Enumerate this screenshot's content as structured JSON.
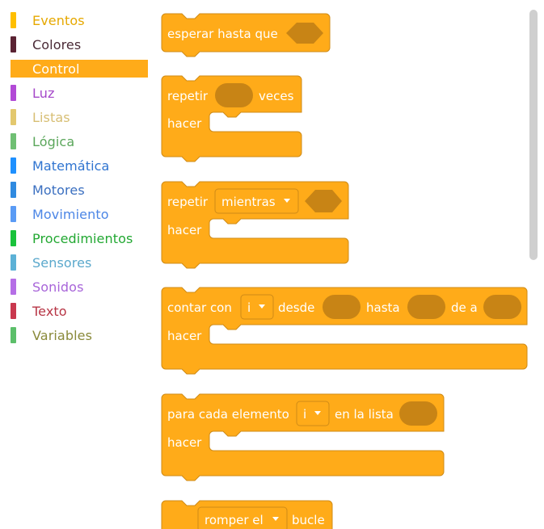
{
  "categories": [
    {
      "label": "Eventos",
      "color": "#ffbf00",
      "text_color": "#e6a800"
    },
    {
      "label": "Colores",
      "color": "#5b2333",
      "text_color": "#4a2a36"
    },
    {
      "label": "Control",
      "color": "#ffab19",
      "text_color": "#ffffff",
      "selected": true
    },
    {
      "label": "Luz",
      "color": "#b24ad6",
      "text_color": "#a548c9"
    },
    {
      "label": "Listas",
      "color": "#e3c86e",
      "text_color": "#d7be73"
    },
    {
      "label": "Lógica",
      "color": "#6fbf73",
      "text_color": "#5aa65a"
    },
    {
      "label": "Matemática",
      "color": "#1e90ff",
      "text_color": "#2f74d0"
    },
    {
      "label": "Motores",
      "color": "#2f8ae0",
      "text_color": "#3a6fc0"
    },
    {
      "label": "Movimiento",
      "color": "#5a9bf5",
      "text_color": "#4c86e6"
    },
    {
      "label": "Procedimientos",
      "color": "#19c23b",
      "text_color": "#22a832"
    },
    {
      "label": "Sensores",
      "color": "#5cb1d6",
      "text_color": "#5aa8cc"
    },
    {
      "label": "Sonidos",
      "color": "#b56ee6",
      "text_color": "#a865d9"
    },
    {
      "label": "Texto",
      "color": "#c9384e",
      "text_color": "#b73545"
    },
    {
      "label": "Variables",
      "color": "#5cbf6a",
      "text_color": "#8a8a3a"
    }
  ],
  "blocks": {
    "wait_until": {
      "label": "esperar hasta que"
    },
    "repeat_times": {
      "label": "repetir",
      "suffix": "veces",
      "do": "hacer"
    },
    "repeat_while": {
      "label": "repetir",
      "mode": "mientras",
      "do": "hacer"
    },
    "for_count": {
      "label": "contar con",
      "var": "i",
      "from": "desde",
      "to": "hasta",
      "by": "de a",
      "do": "hacer"
    },
    "for_each": {
      "label": "para cada elemento",
      "var": "i",
      "in_list": "en la lista",
      "do": "hacer"
    },
    "break_loop": {
      "label": "romper el",
      "suffix": "bucle"
    }
  },
  "colors": {
    "block": "#ffab19",
    "block_border": "#cf8b17",
    "slot": "#c88415",
    "dropdown_border": "#cf8b17",
    "scrollbar": "#cfcfcf"
  }
}
